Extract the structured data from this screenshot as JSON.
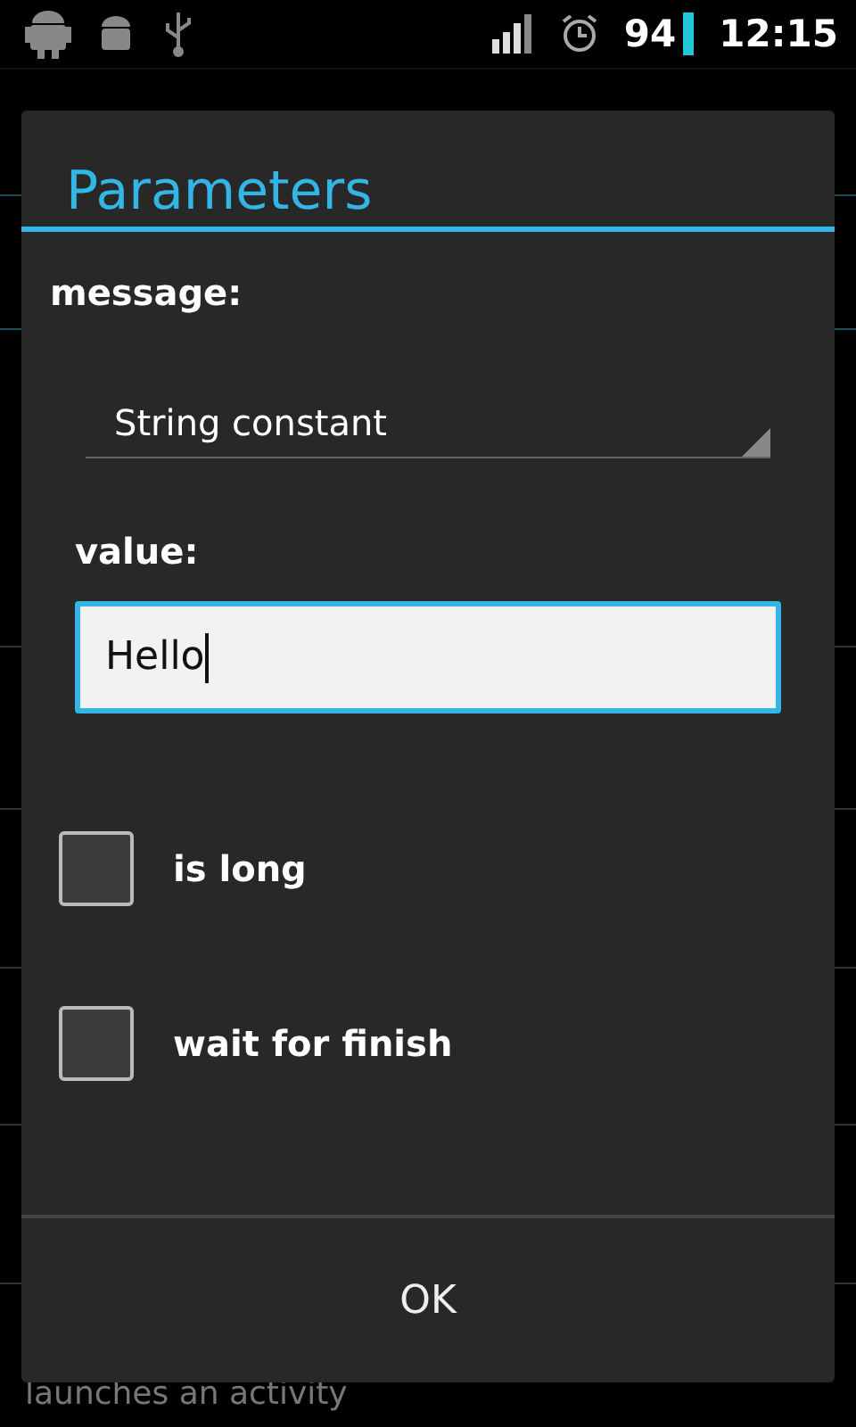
{
  "status_bar": {
    "battery": "94",
    "time": "12:15"
  },
  "background": {
    "caption": "launches an activity"
  },
  "dialog": {
    "title": "Parameters",
    "message_label": "message:",
    "spinner": {
      "value": "String constant"
    },
    "value_label": "value:",
    "value_field": {
      "value": "Hello"
    },
    "options": [
      {
        "label": "is long",
        "checked": false
      },
      {
        "label": "wait for finish",
        "checked": false
      }
    ],
    "buttons": [
      "OK"
    ]
  }
}
